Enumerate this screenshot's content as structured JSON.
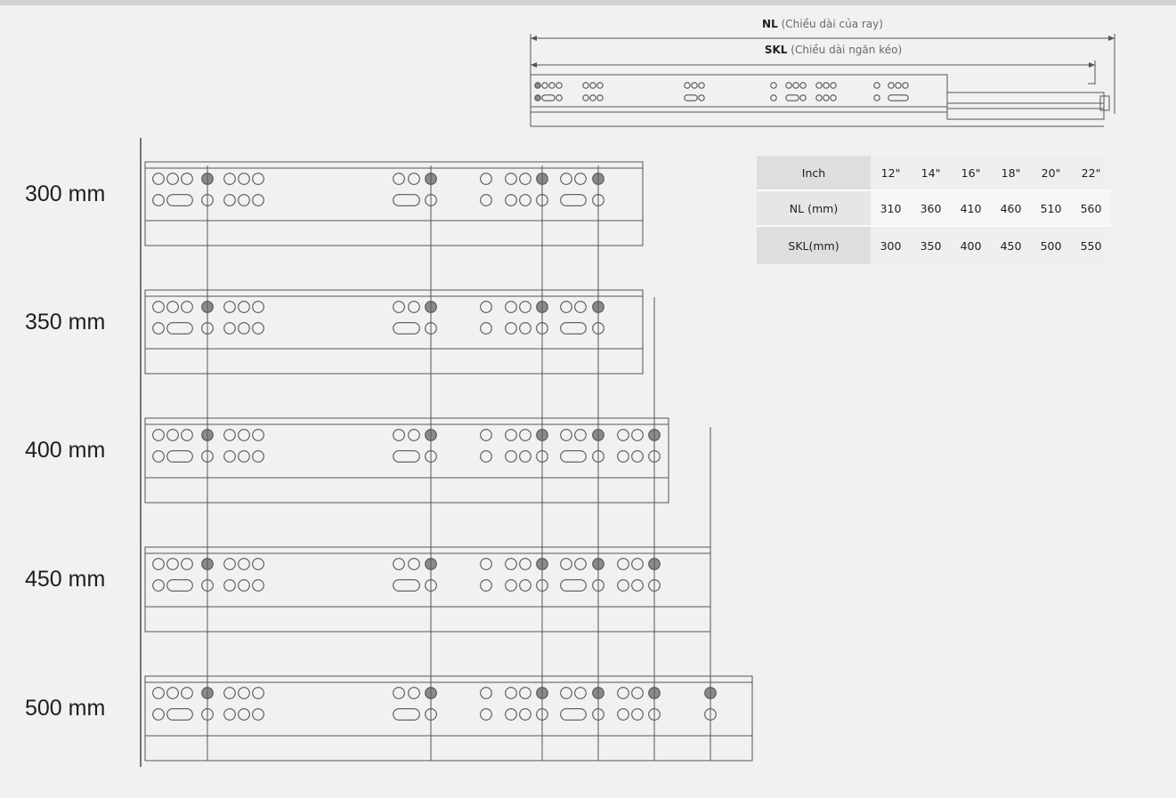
{
  "dimension_labels": {
    "nl_code": "NL",
    "nl_note": "(Chiều dài của ray)",
    "skl_code": "SKL",
    "skl_note": "(Chiều dài ngăn kéo)"
  },
  "rail_sizes": [
    "300 mm",
    "350 mm",
    "400 mm",
    "450 mm",
    "500 mm"
  ],
  "spec_table": {
    "rows": [
      {
        "header": "Inch",
        "values": [
          "12\"",
          "14\"",
          "16\"",
          "18\"",
          "20\"",
          "22\""
        ]
      },
      {
        "header": "NL (mm)",
        "values": [
          "310",
          "360",
          "410",
          "460",
          "510",
          "560"
        ]
      },
      {
        "header": "SKL(mm)",
        "values": [
          "300",
          "350",
          "400",
          "450",
          "500",
          "550"
        ]
      }
    ]
  },
  "colors": {
    "background": "#f1f1f1",
    "line": "#555555",
    "hole_filled": "#8a8a8a",
    "table_header": "#dedede",
    "table_cell": "#efefef"
  }
}
